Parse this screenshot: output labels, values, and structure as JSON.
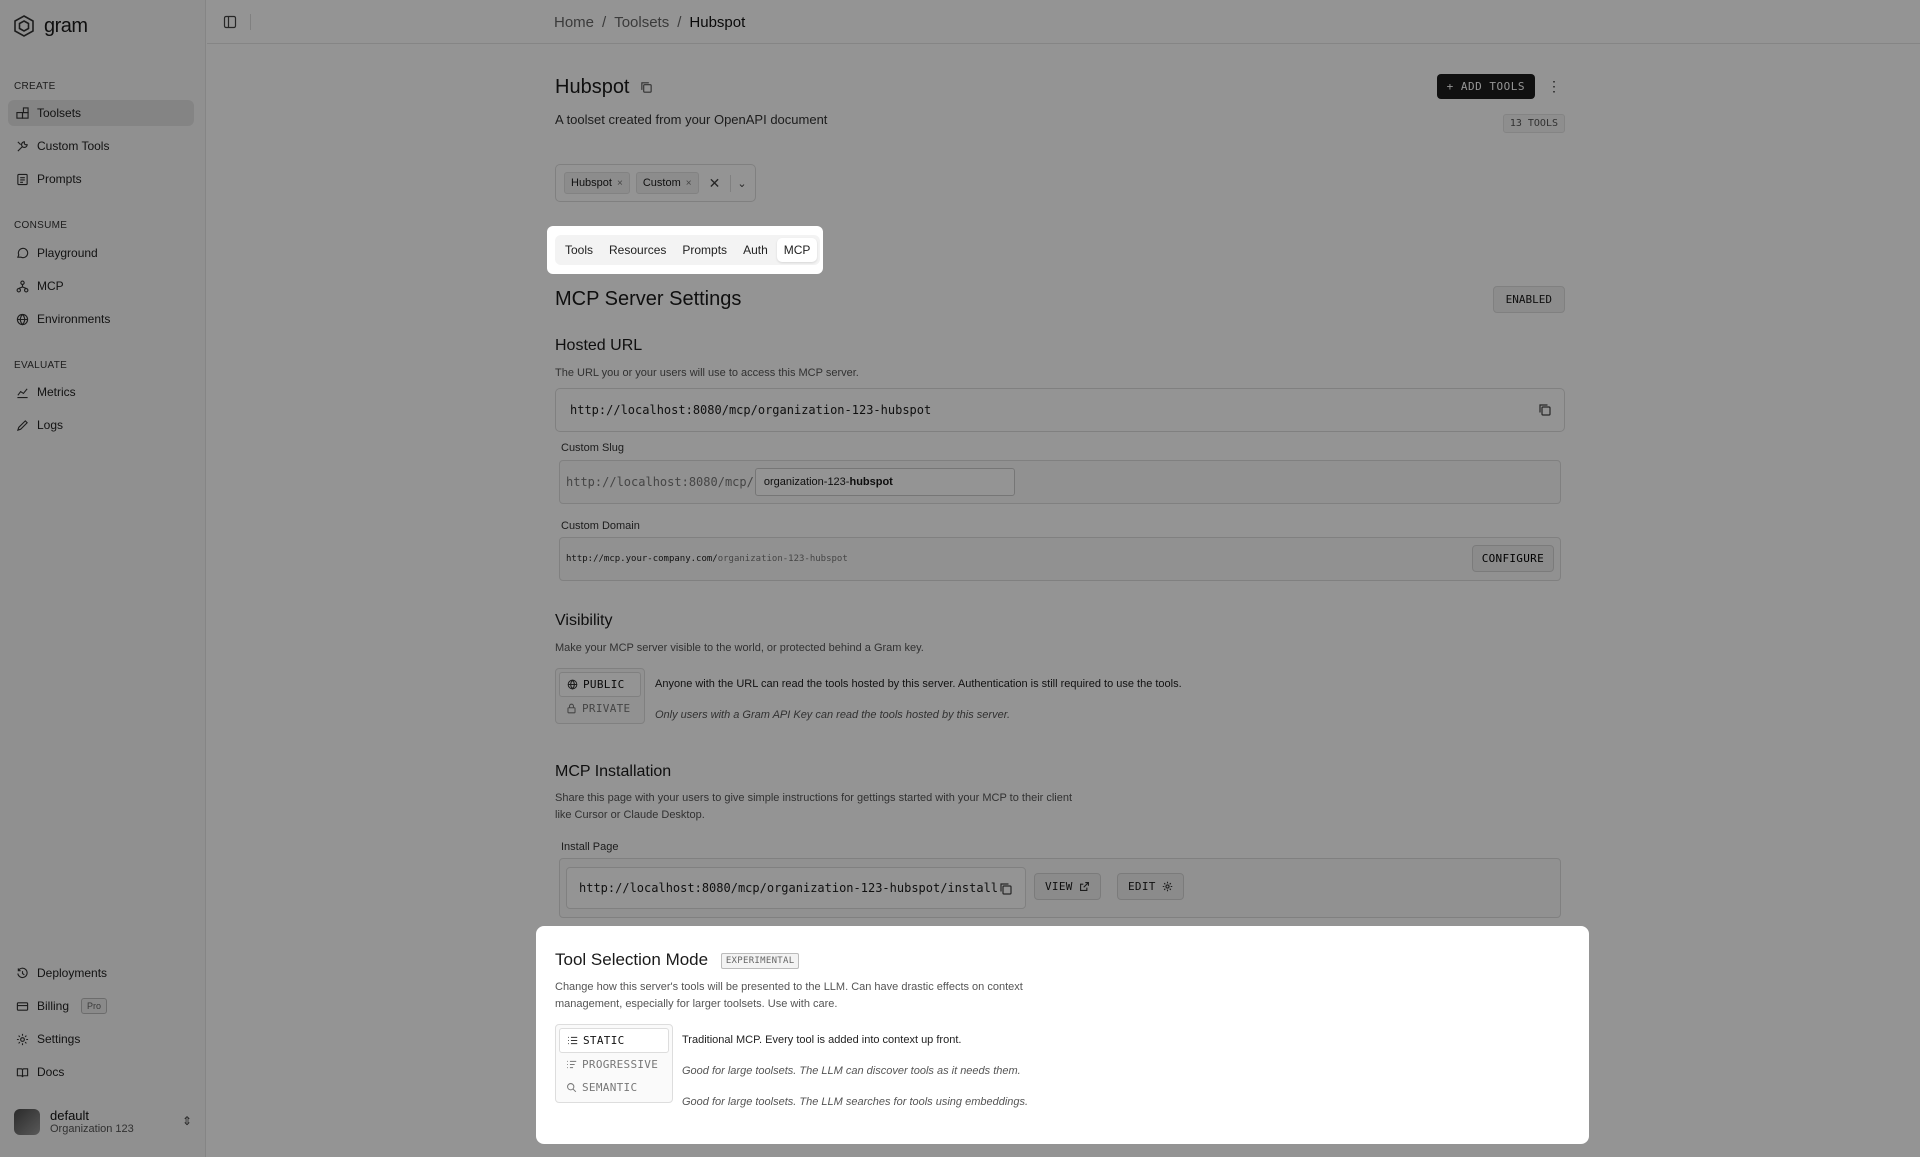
{
  "brand": {
    "name": "gram",
    "logo_icon": "gram-logo-icon"
  },
  "sidebar": {
    "sections": [
      {
        "title": "CREATE",
        "items": [
          {
            "label": "Toolsets",
            "icon": "toolsets-icon",
            "active": true
          },
          {
            "label": "Custom Tools",
            "icon": "custom-tools-icon"
          },
          {
            "label": "Prompts",
            "icon": "prompts-icon"
          }
        ]
      },
      {
        "title": "CONSUME",
        "items": [
          {
            "label": "Playground",
            "icon": "chat-bubble-icon"
          },
          {
            "label": "MCP",
            "icon": "network-icon"
          },
          {
            "label": "Environments",
            "icon": "globe-icon"
          }
        ]
      },
      {
        "title": "EVALUATE",
        "items": [
          {
            "label": "Metrics",
            "icon": "chart-icon"
          },
          {
            "label": "Logs",
            "icon": "pencil-icon"
          }
        ]
      }
    ],
    "bottom_items": [
      {
        "label": "Deployments",
        "icon": "history-icon"
      },
      {
        "label": "Billing",
        "icon": "card-icon",
        "badge": "Pro"
      },
      {
        "label": "Settings",
        "icon": "gear-icon"
      },
      {
        "label": "Docs",
        "icon": "book-icon"
      }
    ],
    "org": {
      "name": "default",
      "subtitle": "Organization 123"
    }
  },
  "breadcrumb": [
    {
      "label": "Home"
    },
    {
      "sep": "/"
    },
    {
      "label": "Toolsets"
    },
    {
      "sep2": "/"
    },
    {
      "label": "Hubspot"
    }
  ],
  "toolset": {
    "title": "Hubspot",
    "description": "A toolset created from your OpenAPI document",
    "add_tools_label": "+ ADD TOOLS",
    "tool_count": "13 TOOLS",
    "tags": [
      "Hubspot",
      "Custom"
    ],
    "tag_remove_glyph": "×",
    "clear_glyph": "✕",
    "caret_glyph": "⌄"
  },
  "tabs": [
    {
      "label": "Tools"
    },
    {
      "label": "Resources"
    },
    {
      "label": "Prompts"
    },
    {
      "label": "Auth"
    },
    {
      "label": "MCP",
      "active": true
    }
  ],
  "mcp": {
    "heading": "MCP Server Settings",
    "status": "ENABLED",
    "hosted_url": {
      "heading": "Hosted URL",
      "description": "The URL you or your users will use to access this MCP server.",
      "url": "http://localhost:8080/mcp/organization-123-hubspot"
    },
    "custom_slug": {
      "label": "Custom Slug",
      "prefix": "http://localhost:8080/mcp/",
      "value_prefix": "organization-123-",
      "value_bold": "hubspot"
    },
    "custom_domain": {
      "label": "Custom Domain",
      "host": "http://mcp.your-company.com/",
      "path": "organization-123-hubspot",
      "button": "CONFIGURE"
    },
    "visibility": {
      "heading": "Visibility",
      "description": "Make your MCP server visible to the world, or protected behind a Gram key.",
      "options": [
        {
          "label": "PUBLIC",
          "icon": "globe-icon",
          "desc": "Anyone with the URL can read the tools hosted by this server. Authentication is still required to use the tools.",
          "active": true
        },
        {
          "label": "PRIVATE",
          "icon": "lock-icon",
          "desc": "Only users with a Gram API Key can read the tools hosted by this server."
        }
      ]
    },
    "installation": {
      "heading": "MCP Installation",
      "description_line1": "Share this page with your users to give simple instructions for gettings started with your MCP to their client",
      "description_line2": "like Cursor or Claude Desktop.",
      "label": "Install Page",
      "url": "http://localhost:8080/mcp/organization-123-hubspot/install",
      "view_label": "VIEW",
      "edit_label": "EDIT"
    },
    "tool_selection": {
      "heading": "Tool Selection Mode",
      "badge": "EXPERIMENTAL",
      "description_line1": "Change how this server's tools will be presented to the LLM. Can have drastic effects on context",
      "description_line2": "management, especially for larger toolsets. Use with care.",
      "options": [
        {
          "label": "STATIC",
          "icon": "list-icon",
          "desc": "Traditional MCP. Every tool is added into context up front.",
          "active": true
        },
        {
          "label": "PROGRESSIVE",
          "icon": "list-filter-icon",
          "desc": "Good for large toolsets. The LLM can discover tools as it needs them."
        },
        {
          "label": "SEMANTIC",
          "icon": "search-icon",
          "desc": "Good for large toolsets. The LLM searches for tools using embeddings."
        }
      ]
    }
  }
}
